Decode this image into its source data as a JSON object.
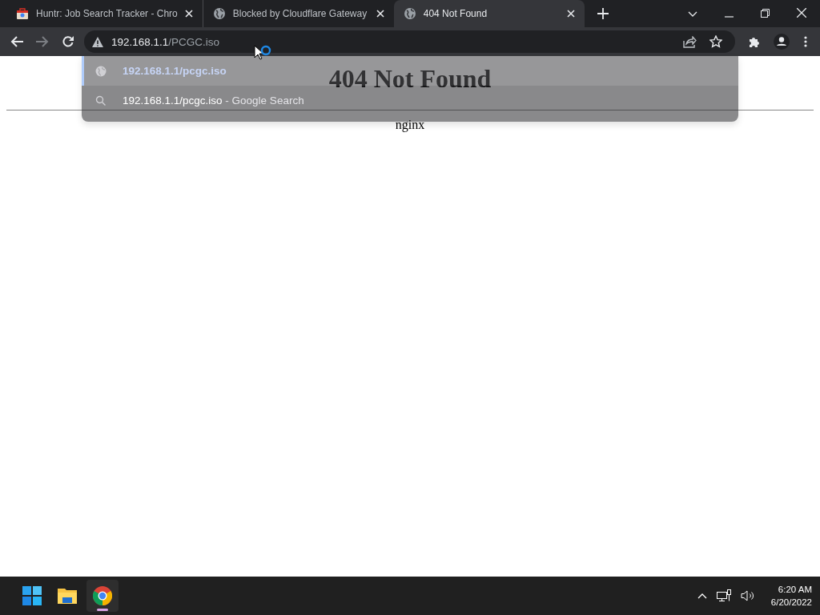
{
  "tabs": [
    {
      "title": "Huntr: Job Search Tracker - Chro",
      "kind": "app",
      "selected": false
    },
    {
      "title": "Blocked by Cloudflare Gateway",
      "kind": "site",
      "selected": false
    },
    {
      "title": "404 Not Found",
      "kind": "site",
      "selected": true
    }
  ],
  "omnibox": {
    "typed": "192.168.1.1",
    "autocompleted": "/PCGC.iso"
  },
  "suggestions": [
    {
      "kind": "url",
      "text": "192.168.1.1/pcgc.iso",
      "selected": true
    },
    {
      "kind": "search",
      "text": "192.168.1.1/pcgc.iso",
      "suffix": " - Google Search",
      "selected": false
    }
  ],
  "page": {
    "heading": "404 Not Found",
    "footer": "nginx"
  },
  "taskbar": {
    "apps": [
      {
        "kind": "start",
        "active": false
      },
      {
        "kind": "explorer",
        "active": false
      },
      {
        "kind": "chrome",
        "active": true
      }
    ],
    "time": "6:20 AM",
    "date": "6/20/2022"
  }
}
